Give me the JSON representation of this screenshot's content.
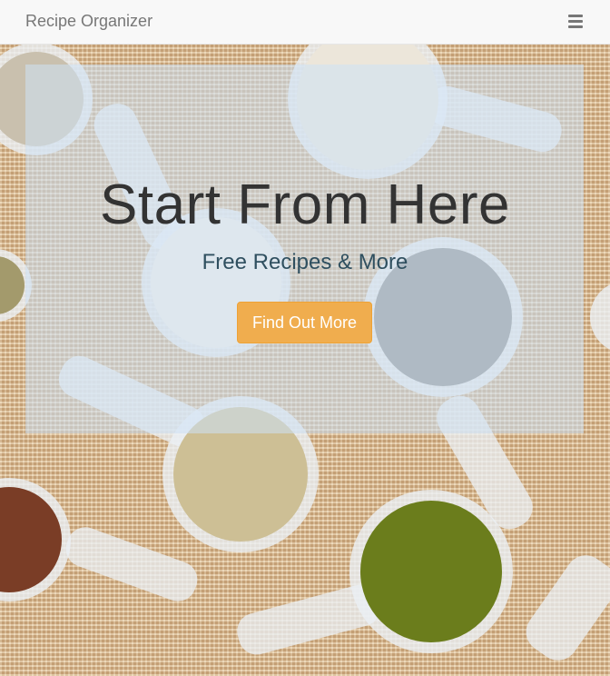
{
  "navbar": {
    "brand": "Recipe Organizer",
    "menu_icon": "hamburger-menu-icon"
  },
  "hero": {
    "title": "Start From Here",
    "subtitle": "Free Recipes & More",
    "cta_label": "Find Out More"
  },
  "colors": {
    "navbar_bg": "#f8f8f8",
    "brand_text": "#777777",
    "cta_bg": "#f0ad4e",
    "panel_tint": "#cde1f5"
  }
}
